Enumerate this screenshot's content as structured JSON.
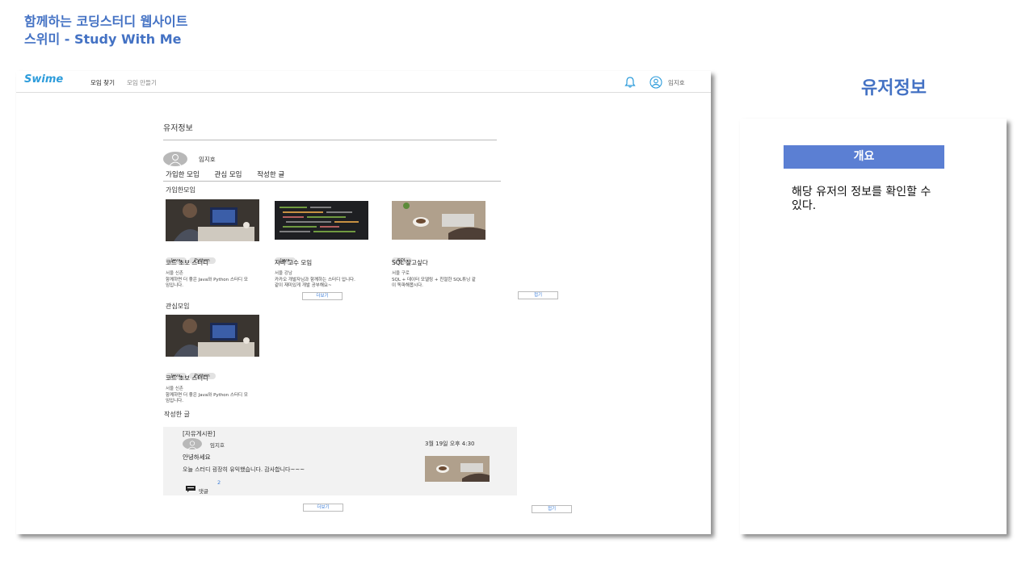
{
  "slide": {
    "title_line1": "함께하는 코딩스터디 웹사이트",
    "title_line2": "스위미 - Study With Me"
  },
  "nav": {
    "logo": "Swime",
    "find_group": "모임 찾기",
    "make_group": "모임 만들기",
    "username": "임지호",
    "icons": [
      "bell-icon",
      "user-icon"
    ]
  },
  "page": {
    "heading": "유저정보",
    "profile_name": "임지호",
    "tabs": [
      "가입한 모임",
      "관심 모임",
      "작성한 글"
    ]
  },
  "joined": {
    "label": "가입한모임",
    "cards": [
      {
        "tags": [
          "Java",
          "Python"
        ],
        "title": "코드 초보 스터디",
        "location": "서울 신촌",
        "desc": "함께하면 더 좋은 Java와 Python 스터디 모임입니다."
      },
      {
        "tags": [
          "Java"
        ],
        "title": "자바 고수 모임",
        "location": "서울 강남",
        "desc": "카카오 개발자님과 함께하는 스터디 입니다. 같이 재미있게 개발 공부해요~"
      },
      {
        "tags": [
          "SQL"
        ],
        "title": "SQL 잘고싶다",
        "location": "서울 구로",
        "desc": "SQL + 데이터 모델링 + 친절한 SQL튜닝 같이 독파해봅시다."
      }
    ],
    "more": "더보기",
    "fold": "접기"
  },
  "interest": {
    "label": "관심모임",
    "cards": [
      {
        "tags": [
          "Java",
          "Python"
        ],
        "title": "코드 초보 스터디",
        "location": "서울 신촌",
        "desc": "함께하면 더 좋은 Java와 Python 스터디 모임입니다."
      }
    ]
  },
  "posts": {
    "label": "작성한 글",
    "items": [
      {
        "board": "[자유게시판]",
        "author": "임지호",
        "date": "3월 19일 오후 4:30",
        "title": "안녕하세요",
        "body": "오늘 스터디 굉장히 유익했습니다. 감사합니다~~~",
        "comment_count": "2",
        "comment_label": "댓글"
      }
    ],
    "more": "더보기",
    "fold": "접기"
  },
  "side": {
    "heading": "유저정보",
    "box": "개요",
    "text": "해당 유저의 정보를 확인할 수 있다."
  },
  "colors": {
    "accent": "#4472c4",
    "box": "#5b7fd3",
    "link": "#3b7dd8",
    "logo": "#2d9cdb"
  }
}
